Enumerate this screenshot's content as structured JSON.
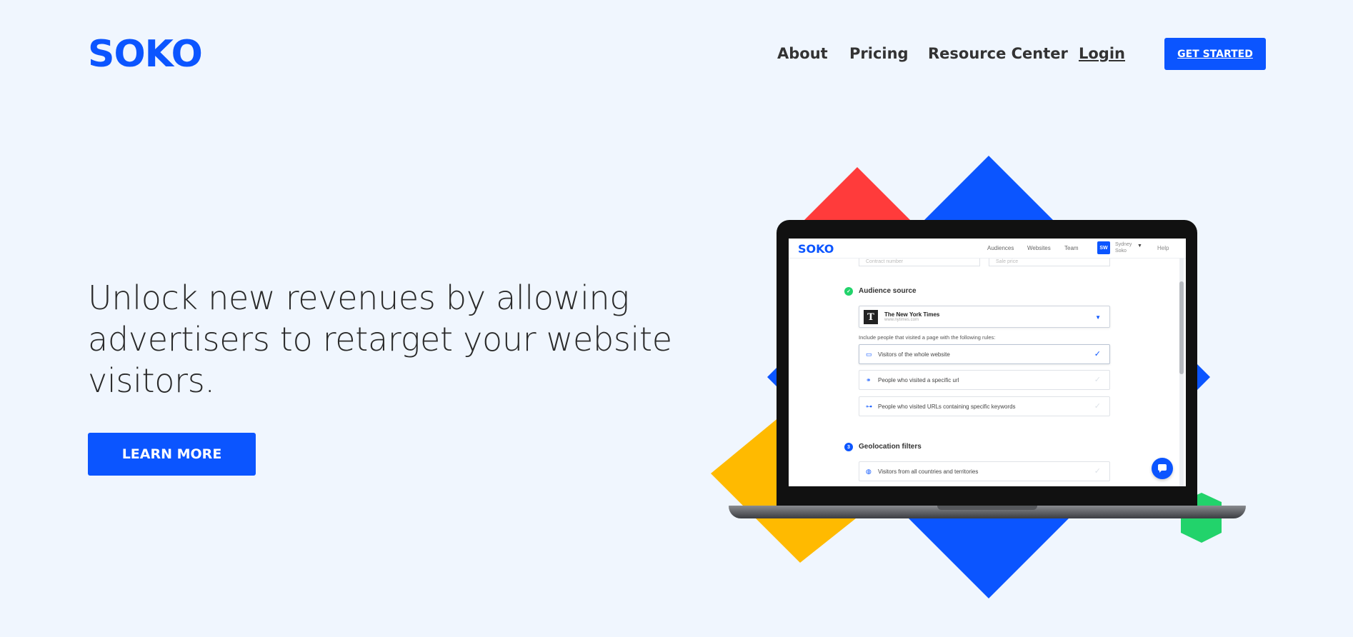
{
  "header": {
    "logo": "SOKO",
    "nav": [
      "About",
      "Pricing",
      "Resource Center"
    ],
    "login": "Login",
    "get_started": "GET STARTED"
  },
  "hero": {
    "headline": "Unlock new revenues by allowing advertisers to retarget your website visitors.",
    "learn_more": "LEARN MORE"
  },
  "colors": {
    "brand_blue": "#0b55ff",
    "red": "#ff3b3b",
    "yellow": "#ffba00",
    "green": "#22d36b",
    "background": "#f0f6fe"
  },
  "app_screen": {
    "logo": "SOKO",
    "nav": [
      "Audiences",
      "Websites",
      "Team"
    ],
    "avatar": "SW",
    "user_name": "Sydney Soko",
    "help": "Help",
    "fields": [
      "Contract number",
      "Sale price"
    ],
    "audience_source": {
      "title": "Audience source",
      "site_name": "The New York Times",
      "site_url": "www.nytimes.com",
      "site_icon": "T",
      "hint": "Include people that visited a page with the following rules:",
      "options": [
        {
          "icon": "browser-icon",
          "label": "Visitors of the whole website",
          "selected": true
        },
        {
          "icon": "link-icon",
          "label": "People who visited a specific url",
          "selected": false
        },
        {
          "icon": "key-icon",
          "label": "People who visited URLs containing specific keywords",
          "selected": false
        }
      ]
    },
    "geolocation": {
      "step": "3",
      "title": "Geolocation filters",
      "option": "Visitors from all countries and territories"
    }
  }
}
